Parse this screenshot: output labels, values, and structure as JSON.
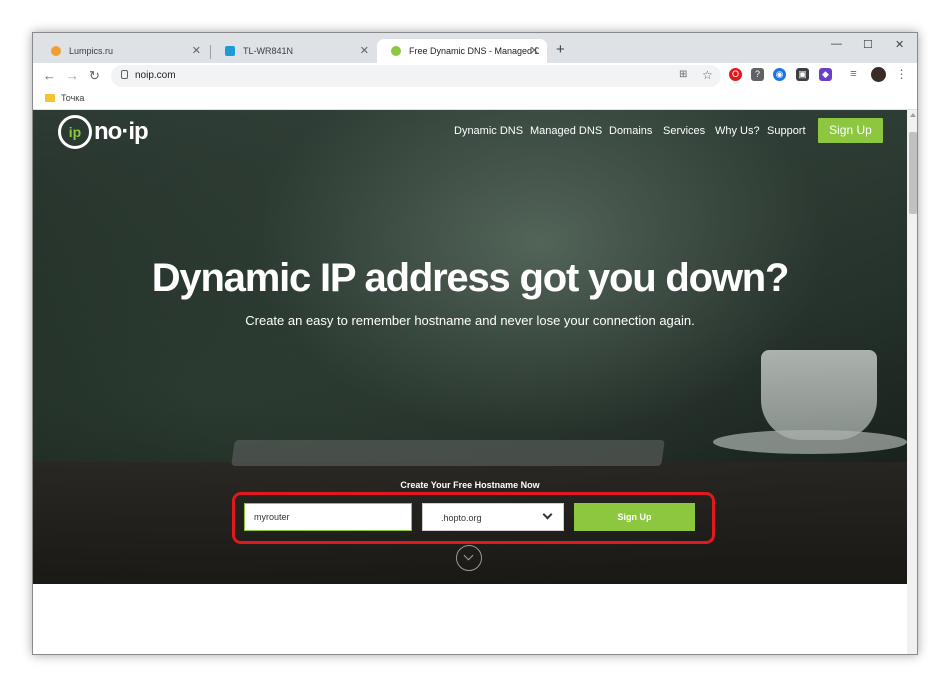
{
  "tabs": [
    {
      "title": "Lumpics.ru",
      "favicon_color": "#f0a030"
    },
    {
      "title": "TL-WR841N",
      "favicon_color": "#1e9bd7"
    },
    {
      "title": "Free Dynamic DNS - Managed D",
      "favicon_color": "#8dc63f"
    }
  ],
  "window_controls": {
    "minimize": "—",
    "maximize": "☐",
    "close": "✕"
  },
  "new_tab_symbol": "+",
  "tab_close_symbol": "✕",
  "toolbar": {
    "back": "←",
    "forward": "→",
    "reload": "↻",
    "url": "noip.com",
    "translate_icon": "⊞",
    "star_icon": "☆"
  },
  "extensions": [
    {
      "icon": "opera-icon",
      "color": "#e0191f",
      "glyph": "O"
    },
    {
      "icon": "question-icon",
      "color": "#5f6368",
      "glyph": "?"
    },
    {
      "icon": "globe-icon",
      "color": "#1a73e8",
      "glyph": "◉"
    },
    {
      "icon": "box-icon",
      "color": "#3c4043",
      "glyph": "▣"
    },
    {
      "icon": "vpn-icon",
      "color": "#6c3fc7",
      "glyph": "◆"
    }
  ],
  "bookmarks": [
    {
      "label": "Точка"
    }
  ],
  "site": {
    "logo_mark": "ip",
    "logo_text": "no·ip",
    "nav": [
      "Dynamic DNS",
      "Managed DNS",
      "Domains",
      "Services",
      "Why Us?",
      "Support"
    ],
    "nav_signup": "Sign Up",
    "headline": "Dynamic IP address got you down?",
    "subhead": "Create an easy to remember hostname and never lose your connection again.",
    "create_label": "Create Your Free Hostname Now",
    "hostname_value": "myrouter",
    "domain_value": ".hopto.org",
    "form_signup": "Sign Up"
  },
  "colors": {
    "accent": "#8dc63f",
    "highlight": "#e0191f"
  }
}
